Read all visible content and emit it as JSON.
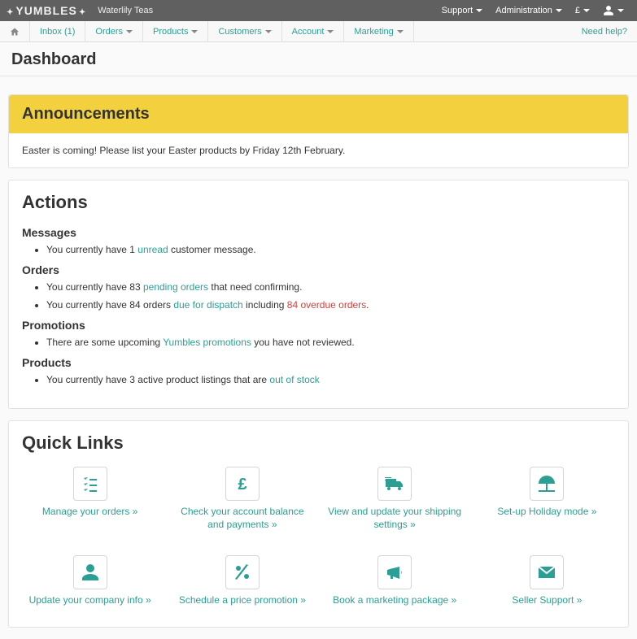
{
  "header": {
    "logo_text": "YUMBLES",
    "shop_name": "Waterlily Teas",
    "support": "Support",
    "admin": "Administration",
    "currency": "£"
  },
  "nav": {
    "inbox": "Inbox (1)",
    "orders": "Orders",
    "products": "Products",
    "customers": "Customers",
    "account": "Account",
    "marketing": "Marketing",
    "need_help": "Need help?"
  },
  "page_title": "Dashboard",
  "announcements": {
    "heading": "Announcements",
    "body": "Easter is coming! Please list your Easter products by Friday 12th February."
  },
  "actions": {
    "heading": "Actions",
    "messages": {
      "heading": "Messages",
      "prefix": "You currently have 1 ",
      "link": "unread",
      "suffix": " customer message."
    },
    "orders": {
      "heading": "Orders",
      "pending_prefix": "You currently have 83 ",
      "pending_link": "pending orders",
      "pending_suffix": " that need confirming.",
      "dispatch_prefix": "You currently have 84 orders ",
      "dispatch_link": "due for dispatch",
      "dispatch_mid": " including ",
      "overdue_link": "84 overdue orders",
      "dispatch_suffix": "."
    },
    "promotions": {
      "heading": "Promotions",
      "prefix": "There are some upcoming ",
      "link": "Yumbles promotions",
      "suffix": " you have not reviewed."
    },
    "products": {
      "heading": "Products",
      "prefix": "You currently have 3 active product listings that are ",
      "link": "out of stock"
    }
  },
  "quicklinks": {
    "heading": "Quick Links",
    "items": [
      {
        "label": "Manage your orders »"
      },
      {
        "label": "Check your account balance and payments »"
      },
      {
        "label": "View and update your shipping settings »"
      },
      {
        "label": "Set-up Holiday mode »"
      },
      {
        "label": "Update your company info »"
      },
      {
        "label": "Schedule a price promotion »"
      },
      {
        "label": "Book a marketing package »"
      },
      {
        "label": "Seller Support »"
      }
    ]
  }
}
